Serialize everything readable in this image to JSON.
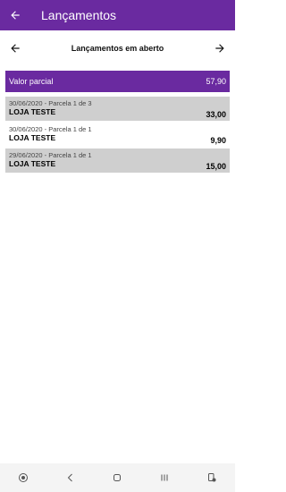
{
  "appbar": {
    "title": "Lançamentos",
    "back_icon": "arrow-left-icon"
  },
  "nav": {
    "title": "Lançamentos em aberto",
    "prev_icon": "arrow-left-icon",
    "next_icon": "arrow-right-icon"
  },
  "partial": {
    "label": "Valor parcial",
    "value": "57,90"
  },
  "items": [
    {
      "date": "30/06/2020 - Parcela 1 de 3",
      "store": "LOJA TESTE",
      "amount": "33,00"
    },
    {
      "date": "30/06/2020 - Parcela 1 de 1",
      "store": "LOJA TESTE",
      "amount": "9,90"
    },
    {
      "date": "29/06/2020 - Parcela 1 de 1",
      "store": "LOJA TESTE",
      "amount": "15,00"
    }
  ],
  "colors": {
    "primary": "#6a2aa0",
    "row_grey": "#cfcfcf"
  },
  "system_bar": {
    "icons": [
      "accessibility-icon",
      "back-icon",
      "home-icon",
      "recents-icon",
      "notification-icon"
    ]
  }
}
